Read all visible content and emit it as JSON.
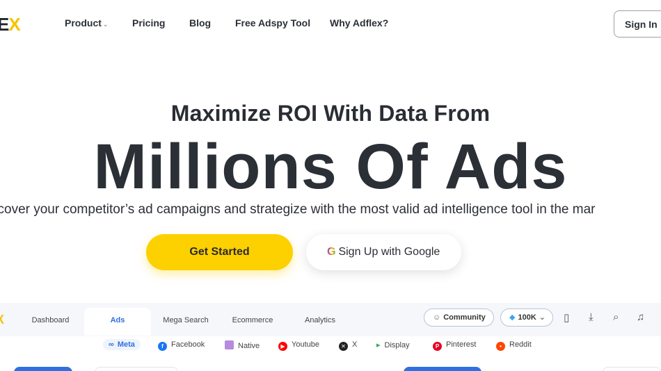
{
  "nav": {
    "logo_text": "E",
    "logo_accent": "X",
    "links": [
      "Product",
      "Pricing",
      "Blog",
      "Free Adspy Tool",
      "Why Adflex?"
    ],
    "product_chevron": "⌄",
    "signin_label": "Sign In"
  },
  "hero": {
    "subtitle": "Maximize ROI With Data From",
    "title": "Millions Of Ads",
    "description": "scover your competitor’s ad campaigns and strategize with the most valid ad intelligence tool in the mar",
    "primary_button": "Get Started",
    "google_button": "Sign Up with Google",
    "google_icon": "G"
  },
  "app": {
    "logo": "X",
    "tabs": [
      "Dashboard",
      "Ads",
      "Mega Search",
      "Ecommerce",
      "Analytics"
    ],
    "active_tab": "Ads",
    "community_label": "Community",
    "credits_label": "100K",
    "tool_icons": [
      "bookmark-icon",
      "download-icon",
      "search-analytics-icon",
      "bell-icon"
    ],
    "platforms": [
      "Meta",
      "Facebook",
      "Native",
      "Youtube",
      "X",
      "Display",
      "Pinterest",
      "Reddit"
    ],
    "active_platform": "Meta"
  },
  "colors": {
    "accent_yellow": "#fdd000",
    "active_blue": "#2f6fe0",
    "text_dark": "#2b2f36"
  }
}
